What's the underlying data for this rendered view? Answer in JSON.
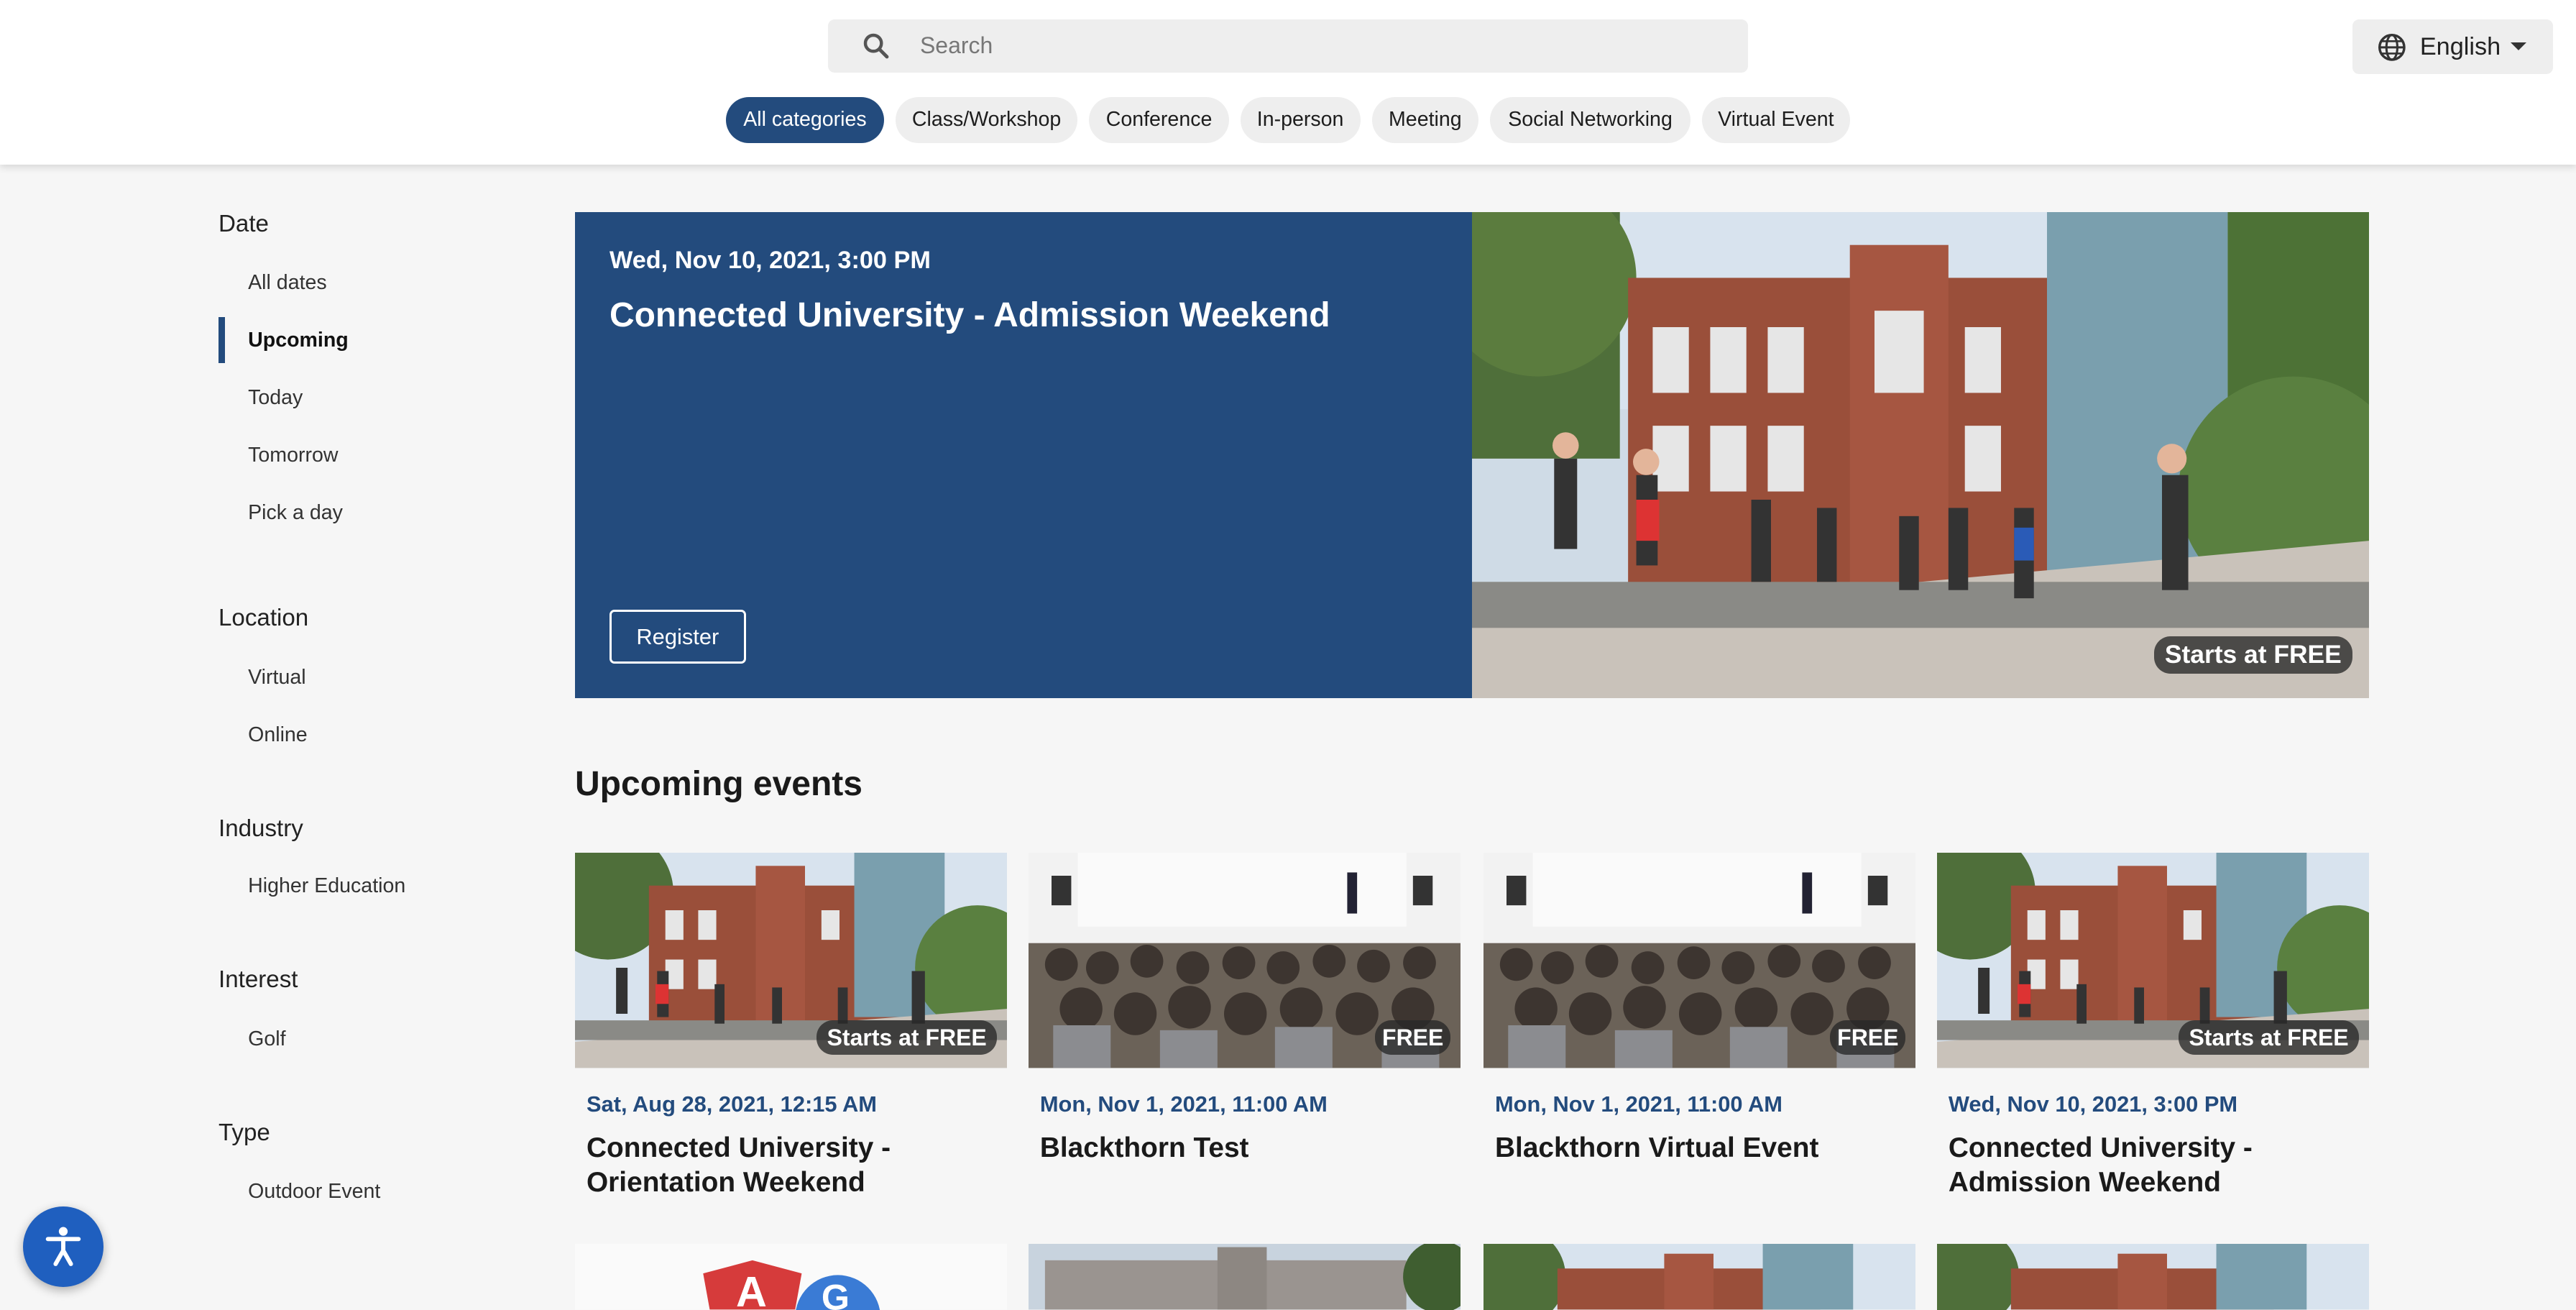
{
  "header": {
    "search_placeholder": "Search",
    "language": "English"
  },
  "categories": [
    {
      "label": "All categories",
      "active": true
    },
    {
      "label": "Class/Workshop",
      "active": false
    },
    {
      "label": "Conference",
      "active": false
    },
    {
      "label": "In-person",
      "active": false
    },
    {
      "label": "Meeting",
      "active": false
    },
    {
      "label": "Social Networking",
      "active": false
    },
    {
      "label": "Virtual Event",
      "active": false
    }
  ],
  "sidebar": {
    "date": {
      "heading": "Date",
      "items": [
        "All dates",
        "Upcoming",
        "Today",
        "Tomorrow",
        "Pick a day"
      ],
      "active": "Upcoming"
    },
    "location": {
      "heading": "Location",
      "items": [
        "Virtual",
        "Online"
      ]
    },
    "industry": {
      "heading": "Industry",
      "items": [
        "Higher Education"
      ]
    },
    "interest": {
      "heading": "Interest",
      "items": [
        "Golf"
      ]
    },
    "type": {
      "heading": "Type",
      "items": [
        "Outdoor Event"
      ]
    }
  },
  "featured": {
    "date": "Wed, Nov 10, 2021, 3:00 PM",
    "title": "Connected University - Admission Weekend",
    "register_label": "Register",
    "price": "Starts at FREE"
  },
  "upcoming": {
    "heading": "Upcoming events",
    "cards": [
      {
        "date": "Sat, Aug 28, 2021, 12:15 AM",
        "title": "Connected University - Orientation Weekend",
        "price": "Starts at FREE",
        "image": "campus-photo"
      },
      {
        "date": "Mon, Nov 1, 2021, 11:00 AM",
        "title": "Blackthorn Test",
        "price": "FREE",
        "image": "conference-audience-photo"
      },
      {
        "date": "Mon, Nov 1, 2021, 11:00 AM",
        "title": "Blackthorn Virtual Event",
        "price": "FREE",
        "image": "conference-audience-photo"
      },
      {
        "date": "Wed, Nov 10, 2021, 3:00 PM",
        "title": "Connected University - Admission Weekend",
        "price": "Starts at FREE",
        "image": "campus-photo"
      }
    ]
  },
  "colors": {
    "brand": "#234b7d",
    "accessibility": "#1f5fbf"
  }
}
